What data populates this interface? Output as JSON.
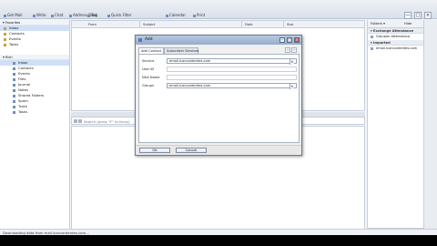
{
  "toolbar": {
    "items": [
      "Get Mail",
      "Write",
      "Chat",
      "Address Book",
      "Tag",
      "Quick Filter",
      "Calendar",
      "Print"
    ],
    "window_controls": [
      "—",
      "□",
      "×"
    ]
  },
  "nav": {
    "section_favorites": "▾ Favorites",
    "favorites": [
      "Inbox",
      "Contacts",
      "Events",
      "Tasks"
    ],
    "section_account": "▾ Rich",
    "folders": [
      "Inbox",
      "Contacts",
      "Events",
      "Files",
      "Journal",
      "Notes",
      "Shared Folders",
      "Spam",
      "Trash",
      "Tasks"
    ]
  },
  "list": {
    "columns": [
      "From",
      "Subject",
      "Date",
      "Size"
    ]
  },
  "search": {
    "placeholder": "Search (press \"F\" to focus)"
  },
  "right": {
    "buttons": [
      "Folders ▾",
      "Hide"
    ],
    "section_1": "▾ Exchange Attendance",
    "section_1_item": "Groupon Attendance",
    "section_2": "▾ Imported",
    "section_2_item": "email.iconcordentes.com",
    "bottom": [
      "Add",
      "More"
    ]
  },
  "status": {
    "text": "Downloading data from mail.iconcordentes.com..."
  },
  "dialog": {
    "title": "Add",
    "tabs": [
      "Add Contact",
      "Subscriber Services"
    ],
    "fields": {
      "service_label": "Service",
      "service_value": "email.iconcordentes.com",
      "userid_label": "User ID",
      "userid_value": "",
      "nickname_label": "Nick Name",
      "nickname_value": "",
      "groups_label": "Groups",
      "groups_value": "email.iconcordentes.com"
    },
    "ok": "OK",
    "cancel": "Cancel"
  }
}
